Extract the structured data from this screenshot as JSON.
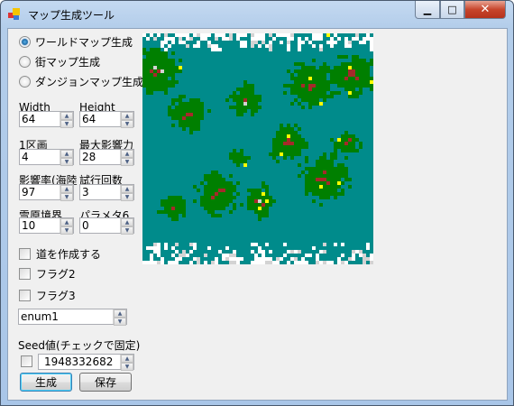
{
  "window": {
    "title": "マップ生成ツール",
    "controls": {
      "minimize": "minimize-icon",
      "maximize": "maximize-icon",
      "close": "close-icon"
    }
  },
  "mode": {
    "options": [
      {
        "label": "ワールドマップ生成",
        "selected": true
      },
      {
        "label": "街マップ生成",
        "selected": false
      },
      {
        "label": "ダンジョンマップ生成",
        "selected": false
      }
    ]
  },
  "params": [
    {
      "label": "Width",
      "value": "64"
    },
    {
      "label": "Height",
      "value": "64"
    },
    {
      "label": "1区画",
      "value": "4"
    },
    {
      "label": "最大影響力",
      "value": "28"
    },
    {
      "label": "影響率(海陸",
      "value": "97"
    },
    {
      "label": "試行回数",
      "value": "3"
    },
    {
      "label": "雪原境界",
      "value": "10"
    },
    {
      "label": "パラメタ6",
      "value": "0"
    }
  ],
  "flags": [
    {
      "label": "道を作成する",
      "checked": false
    },
    {
      "label": "フラグ2",
      "checked": false
    },
    {
      "label": "フラグ3",
      "checked": false
    }
  ],
  "enum_select": {
    "value": "enum1"
  },
  "seed": {
    "label": "Seed値(チェックで固定)",
    "checked": false,
    "value": "1948332682"
  },
  "buttons": {
    "generate": "生成",
    "save": "保存"
  },
  "map": {
    "colors": {
      "sea": "#008b8b",
      "land": "#007f00",
      "mountain": "#a52a2a",
      "snow": "#ffffff",
      "rock": "#d3d3d3",
      "town": "#ffff00"
    }
  }
}
